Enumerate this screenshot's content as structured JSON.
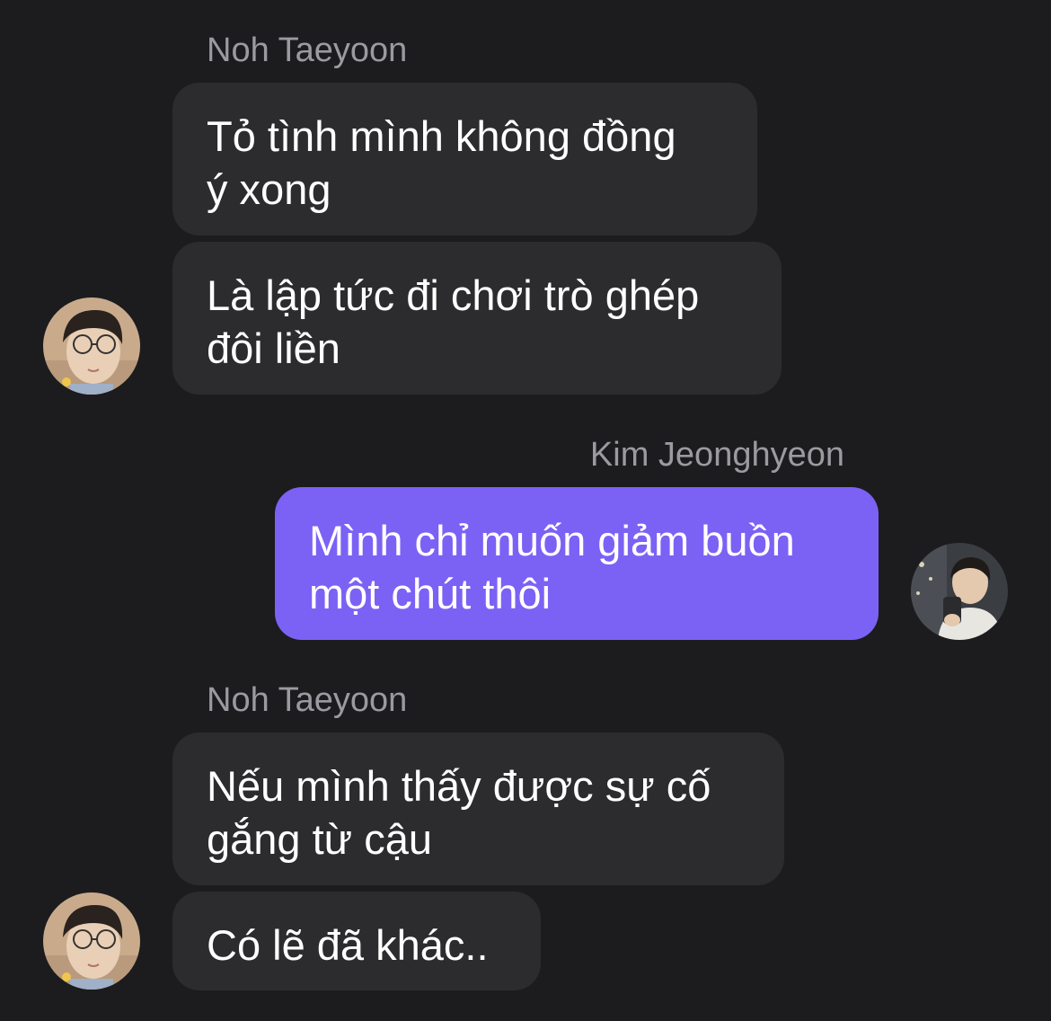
{
  "messages": [
    {
      "sender": "Noh Taeyoon",
      "text": "Tỏ tình mình không đồng\ný xong"
    },
    {
      "sender": "Noh Taeyoon",
      "text": "Là lập tức đi chơi trò ghép\nđôi liền"
    },
    {
      "sender": "Kim Jeonghyeon",
      "text": "Mình chỉ muốn giảm buồn\nmột chút thôi"
    },
    {
      "sender": "Noh Taeyoon",
      "text": "Nếu mình thấy được sự cố\ngắng từ cậu"
    },
    {
      "sender": "Noh Taeyoon",
      "text": "Có lẽ đã khác.."
    }
  ],
  "sender_labels": [
    "Noh Taeyoon",
    "Kim Jeonghyeon",
    "Noh Taeyoon"
  ],
  "colors": {
    "background": "#1c1c1e",
    "incoming_bubble": "#2c2c2e",
    "outgoing_bubble": "#7b62f5",
    "sender_name": "#9a9aa0",
    "message_text": "#ffffff"
  },
  "icons": [
    "avatar-noh-taeyoon",
    "avatar-kim-jeonghyeon"
  ]
}
